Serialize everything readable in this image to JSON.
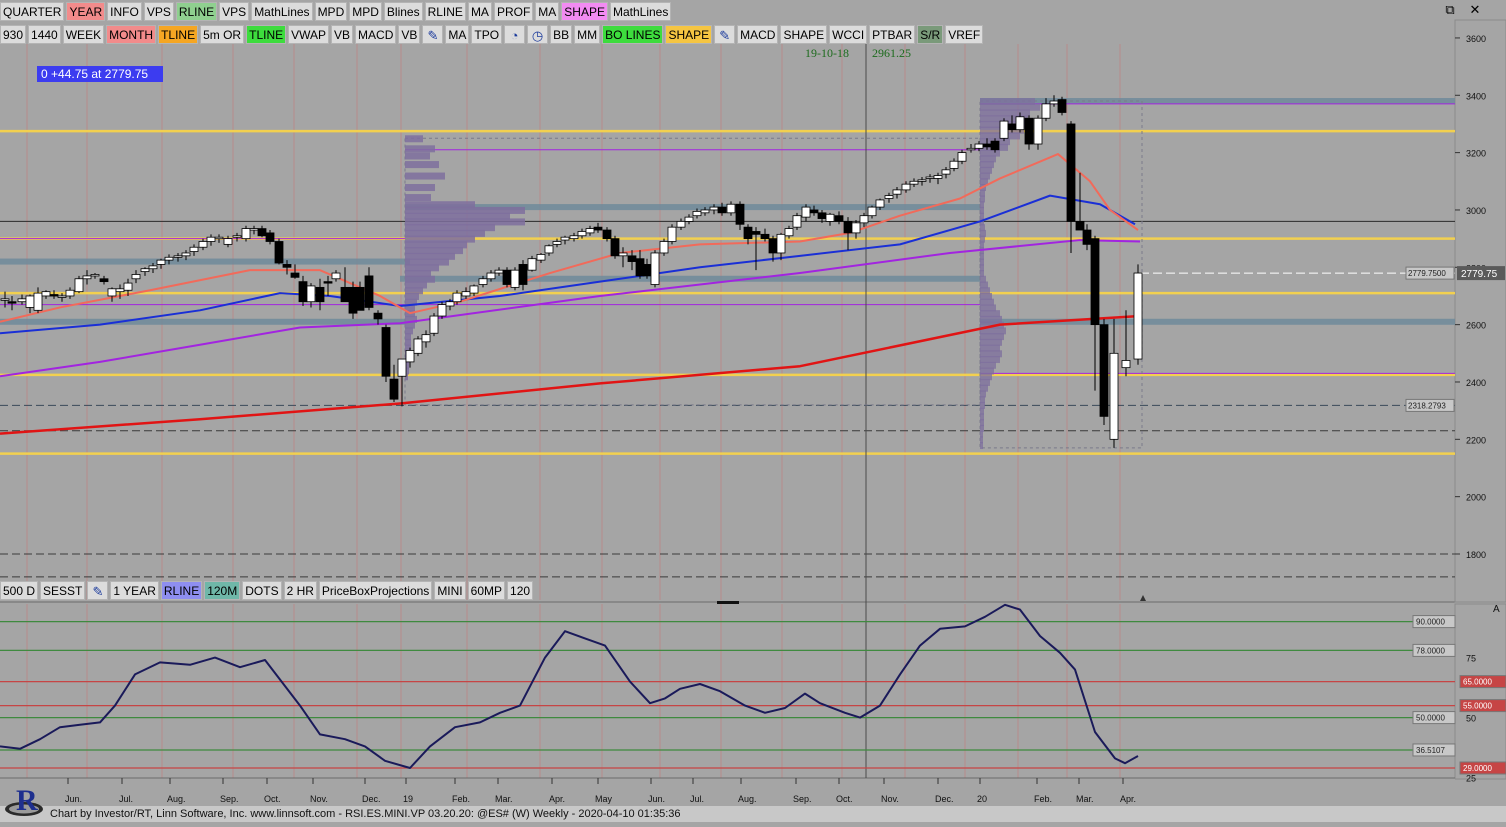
{
  "toolbar1": [
    "QUARTER",
    "YEAR",
    "INFO",
    "VPS",
    "RLINE",
    "VPS",
    "MathLines",
    "MPD",
    "MPD",
    "Blines",
    "RLINE",
    "MA",
    "PROF",
    "MA",
    "SHAPE",
    "MathLines"
  ],
  "toolbar1_colors": [
    "#dcdcdc",
    "#f28b8b",
    "#dcdcdc",
    "#dcdcdc",
    "#8fd08f",
    "#dcdcdc",
    "#dcdcdc",
    "#dcdcdc",
    "#dcdcdc",
    "#dcdcdc",
    "#dcdcdc",
    "#dcdcdc",
    "#dcdcdc",
    "#dcdcdc",
    "#f28bf2",
    "#dcdcdc"
  ],
  "toolbar2": [
    {
      "label": "930"
    },
    {
      "label": "1440"
    },
    {
      "label": "WEEK"
    },
    {
      "label": "MONTH",
      "color": "#f28b8b"
    },
    {
      "label": "TLINE",
      "color": "#f5a623"
    },
    {
      "label": "5m OR"
    },
    {
      "label": "TLINE",
      "color": "#3ddc3d"
    },
    {
      "label": "VWAP"
    },
    {
      "label": "VB"
    },
    {
      "label": "MACD"
    },
    {
      "label": "VB"
    },
    {
      "icon": "pencil-icon",
      "glyph": "✎"
    },
    {
      "label": "MA"
    },
    {
      "label": "TPO"
    },
    {
      "icon": "clock-icon",
      "glyph": "◔"
    },
    {
      "icon": "stopwatch-icon",
      "glyph": "◷"
    },
    {
      "label": "BB"
    },
    {
      "label": "MM"
    },
    {
      "label": "BO LINES",
      "color": "#3ddc3d"
    },
    {
      "label": "SHAPE",
      "color": "#f5c542"
    },
    {
      "icon": "pencil-icon",
      "glyph": "✎"
    },
    {
      "label": "MACD"
    },
    {
      "label": "SHAPE"
    },
    {
      "label": "WCCI"
    },
    {
      "label": "PTBAR"
    },
    {
      "label": "S/R",
      "color": "#7a9a7a"
    },
    {
      "label": "VREF"
    }
  ],
  "toolbar3": [
    {
      "label": "500 D"
    },
    {
      "label": "SESST"
    },
    {
      "icon": "pencil-icon",
      "glyph": "✎"
    },
    {
      "label": "1 YEAR"
    },
    {
      "label": "RLINE",
      "color": "#8e8ef0"
    },
    {
      "label": "120M",
      "color": "#6fb7a8"
    },
    {
      "label": "DOTS"
    },
    {
      "label": "2 HR"
    },
    {
      "label": "PriceBoxProjections"
    },
    {
      "label": "MINI"
    },
    {
      "label": "60MP"
    },
    {
      "label": "120"
    }
  ],
  "window_controls": {
    "restore": "⧉",
    "close": "✕"
  },
  "cursor_readout": {
    "date": "19-10-18",
    "price": "2961.25"
  },
  "info_box": "0  +44.75 at 2779.75",
  "price_axis": {
    "ticks": [
      "3600",
      "3400",
      "3200",
      "3000",
      "2800",
      "2600",
      "2400",
      "2200",
      "2000",
      "1800"
    ],
    "current_price": "2779.75",
    "marker_left": "2779.7500",
    "level_2318": "2318.2793"
  },
  "rsi_axis": {
    "labels": [
      "90.0000",
      "78.0000",
      "65.0000",
      "55.0000",
      "50.0000",
      "36.5107",
      "29.0000"
    ],
    "ticks": [
      "75",
      "50",
      "25"
    ],
    "top_marker": "A"
  },
  "x_axis": [
    "Jun.",
    "Jul.",
    "Aug.",
    "Sep.",
    "Oct.",
    "Nov.",
    "Dec.",
    "19",
    "Feb.",
    "Mar.",
    "Apr.",
    "May",
    "Jun.",
    "Jul.",
    "Aug.",
    "Sep.",
    "Oct.",
    "Nov.",
    "Dec.",
    "20",
    "Feb.",
    "Mar.",
    "Apr."
  ],
  "footer": "Chart by Investor/RT, Linn Software, Inc. www.linnsoft.com - RSI.ES.MINI.VP     03.20.20: @ES# (W) Weekly - 2020-04-10 01:35:36",
  "logo_letter": "R",
  "colors": {
    "background": "#a5a5a5",
    "up_candle": "#ffffff",
    "down_candle": "#000000",
    "ma_fast": "#f26a5a",
    "ma_mid": "#1a2fd6",
    "ma_slow": "#a224e0",
    "ma_200": "#e11414",
    "yellow_level": "#f2d04f",
    "steel_level": "#6f8a9a",
    "volume_profile": "#7e6f9e",
    "rsi_line": "#1a1a5a",
    "grid_vertical": "#b88a8a"
  },
  "chart_data": {
    "type": "candlestick",
    "series": "@ES# (W) Weekly",
    "ylim": [
      1700,
      3650
    ],
    "price_levels": {
      "yellow": [
        2150,
        2425,
        2710,
        2900,
        3275
      ],
      "steel": [
        2610,
        2760,
        2820,
        3010,
        3380
      ],
      "dashed": [
        2318.28,
        2779.75
      ]
    },
    "candles": [
      {
        "x": 5,
        "o": 2685,
        "h": 2715,
        "l": 2660,
        "c": 2690
      },
      {
        "x": 12,
        "o": 2680,
        "h": 2700,
        "l": 2650,
        "c": 2675
      },
      {
        "x": 22,
        "o": 2680,
        "h": 2705,
        "l": 2670,
        "c": 2690
      },
      {
        "x": 30,
        "o": 2660,
        "h": 2705,
        "l": 2640,
        "c": 2700
      },
      {
        "x": 38,
        "o": 2650,
        "h": 2730,
        "l": 2640,
        "c": 2710
      },
      {
        "x": 46,
        "o": 2700,
        "h": 2720,
        "l": 2690,
        "c": 2715
      },
      {
        "x": 54,
        "o": 2705,
        "h": 2720,
        "l": 2690,
        "c": 2700
      },
      {
        "x": 62,
        "o": 2695,
        "h": 2710,
        "l": 2680,
        "c": 2700
      },
      {
        "x": 70,
        "o": 2700,
        "h": 2730,
        "l": 2690,
        "c": 2720
      },
      {
        "x": 79,
        "o": 2715,
        "h": 2770,
        "l": 2710,
        "c": 2760
      },
      {
        "x": 87,
        "o": 2760,
        "h": 2790,
        "l": 2740,
        "c": 2770
      },
      {
        "x": 95,
        "o": 2770,
        "h": 2780,
        "l": 2760,
        "c": 2775
      },
      {
        "x": 104,
        "o": 2760,
        "h": 2770,
        "l": 2740,
        "c": 2750
      },
      {
        "x": 112,
        "o": 2700,
        "h": 2730,
        "l": 2680,
        "c": 2725
      },
      {
        "x": 120,
        "o": 2715,
        "h": 2740,
        "l": 2690,
        "c": 2725
      },
      {
        "x": 128,
        "o": 2720,
        "h": 2760,
        "l": 2700,
        "c": 2745
      },
      {
        "x": 136,
        "o": 2760,
        "h": 2790,
        "l": 2745,
        "c": 2775
      },
      {
        "x": 145,
        "o": 2785,
        "h": 2800,
        "l": 2770,
        "c": 2795
      },
      {
        "x": 153,
        "o": 2795,
        "h": 2815,
        "l": 2780,
        "c": 2805
      },
      {
        "x": 161,
        "o": 2810,
        "h": 2830,
        "l": 2795,
        "c": 2825
      },
      {
        "x": 169,
        "o": 2825,
        "h": 2845,
        "l": 2810,
        "c": 2835
      },
      {
        "x": 178,
        "o": 2835,
        "h": 2850,
        "l": 2820,
        "c": 2840
      },
      {
        "x": 186,
        "o": 2840,
        "h": 2860,
        "l": 2825,
        "c": 2850
      },
      {
        "x": 194,
        "o": 2855,
        "h": 2880,
        "l": 2840,
        "c": 2870
      },
      {
        "x": 203,
        "o": 2870,
        "h": 2900,
        "l": 2860,
        "c": 2890
      },
      {
        "x": 211,
        "o": 2890,
        "h": 2915,
        "l": 2875,
        "c": 2905
      },
      {
        "x": 219,
        "o": 2900,
        "h": 2915,
        "l": 2885,
        "c": 2905
      },
      {
        "x": 228,
        "o": 2880,
        "h": 2910,
        "l": 2870,
        "c": 2900
      },
      {
        "x": 237,
        "o": 2905,
        "h": 2920,
        "l": 2890,
        "c": 2910
      },
      {
        "x": 246,
        "o": 2900,
        "h": 2945,
        "l": 2890,
        "c": 2935
      },
      {
        "x": 254,
        "o": 2930,
        "h": 2945,
        "l": 2915,
        "c": 2935
      },
      {
        "x": 262,
        "o": 2935,
        "h": 2945,
        "l": 2905,
        "c": 2910
      },
      {
        "x": 270,
        "o": 2920,
        "h": 2930,
        "l": 2880,
        "c": 2890
      },
      {
        "x": 279,
        "o": 2890,
        "h": 2900,
        "l": 2810,
        "c": 2815
      },
      {
        "x": 287,
        "o": 2810,
        "h": 2825,
        "l": 2775,
        "c": 2800
      },
      {
        "x": 295,
        "o": 2780,
        "h": 2810,
        "l": 2760,
        "c": 2765
      },
      {
        "x": 303,
        "o": 2750,
        "h": 2770,
        "l": 2665,
        "c": 2680
      },
      {
        "x": 311,
        "o": 2680,
        "h": 2745,
        "l": 2660,
        "c": 2735
      },
      {
        "x": 320,
        "o": 2730,
        "h": 2760,
        "l": 2650,
        "c": 2680
      },
      {
        "x": 328,
        "o": 2750,
        "h": 2770,
        "l": 2700,
        "c": 2745
      },
      {
        "x": 336,
        "o": 2760,
        "h": 2790,
        "l": 2750,
        "c": 2780
      },
      {
        "x": 345,
        "o": 2730,
        "h": 2800,
        "l": 2680,
        "c": 2680
      },
      {
        "x": 353,
        "o": 2730,
        "h": 2750,
        "l": 2620,
        "c": 2640
      },
      {
        "x": 360,
        "o": 2730,
        "h": 2750,
        "l": 2650,
        "c": 2650
      },
      {
        "x": 369,
        "o": 2770,
        "h": 2800,
        "l": 2650,
        "c": 2660
      },
      {
        "x": 378,
        "o": 2640,
        "h": 2650,
        "l": 2600,
        "c": 2620
      },
      {
        "x": 386,
        "o": 2590,
        "h": 2600,
        "l": 2400,
        "c": 2420
      },
      {
        "x": 394,
        "o": 2410,
        "h": 2460,
        "l": 2330,
        "c": 2340
      },
      {
        "x": 402,
        "o": 2420,
        "h": 2480,
        "l": 2315,
        "c": 2480
      },
      {
        "x": 410,
        "o": 2470,
        "h": 2520,
        "l": 2450,
        "c": 2510
      },
      {
        "x": 418,
        "o": 2500,
        "h": 2560,
        "l": 2490,
        "c": 2550
      },
      {
        "x": 426,
        "o": 2540,
        "h": 2580,
        "l": 2520,
        "c": 2565
      },
      {
        "x": 434,
        "o": 2570,
        "h": 2640,
        "l": 2560,
        "c": 2630
      },
      {
        "x": 442,
        "o": 2630,
        "h": 2680,
        "l": 2620,
        "c": 2670
      },
      {
        "x": 450,
        "o": 2665,
        "h": 2690,
        "l": 2650,
        "c": 2680
      },
      {
        "x": 457,
        "o": 2680,
        "h": 2720,
        "l": 2670,
        "c": 2710
      },
      {
        "x": 466,
        "o": 2700,
        "h": 2730,
        "l": 2690,
        "c": 2715
      },
      {
        "x": 474,
        "o": 2710,
        "h": 2740,
        "l": 2700,
        "c": 2735
      },
      {
        "x": 483,
        "o": 2740,
        "h": 2770,
        "l": 2730,
        "c": 2760
      },
      {
        "x": 491,
        "o": 2760,
        "h": 2790,
        "l": 2750,
        "c": 2780
      },
      {
        "x": 499,
        "o": 2780,
        "h": 2800,
        "l": 2770,
        "c": 2790
      },
      {
        "x": 507,
        "o": 2790,
        "h": 2800,
        "l": 2730,
        "c": 2740
      },
      {
        "x": 515,
        "o": 2730,
        "h": 2800,
        "l": 2720,
        "c": 2790
      },
      {
        "x": 523,
        "o": 2810,
        "h": 2825,
        "l": 2720,
        "c": 2740
      },
      {
        "x": 532,
        "o": 2790,
        "h": 2840,
        "l": 2785,
        "c": 2830
      },
      {
        "x": 541,
        "o": 2825,
        "h": 2850,
        "l": 2815,
        "c": 2845
      },
      {
        "x": 549,
        "o": 2850,
        "h": 2880,
        "l": 2840,
        "c": 2875
      },
      {
        "x": 557,
        "o": 2880,
        "h": 2900,
        "l": 2870,
        "c": 2890
      },
      {
        "x": 565,
        "o": 2895,
        "h": 2910,
        "l": 2880,
        "c": 2905
      },
      {
        "x": 574,
        "o": 2900,
        "h": 2920,
        "l": 2890,
        "c": 2910
      },
      {
        "x": 582,
        "o": 2910,
        "h": 2935,
        "l": 2900,
        "c": 2925
      },
      {
        "x": 590,
        "o": 2920,
        "h": 2945,
        "l": 2910,
        "c": 2935
      },
      {
        "x": 598,
        "o": 2940,
        "h": 2955,
        "l": 2920,
        "c": 2930
      },
      {
        "x": 607,
        "o": 2930,
        "h": 2940,
        "l": 2890,
        "c": 2900
      },
      {
        "x": 615,
        "o": 2900,
        "h": 2910,
        "l": 2830,
        "c": 2840
      },
      {
        "x": 623,
        "o": 2840,
        "h": 2870,
        "l": 2800,
        "c": 2850
      },
      {
        "x": 632,
        "o": 2840,
        "h": 2860,
        "l": 2790,
        "c": 2820
      },
      {
        "x": 640,
        "o": 2830,
        "h": 2860,
        "l": 2760,
        "c": 2770
      },
      {
        "x": 647,
        "o": 2810,
        "h": 2830,
        "l": 2760,
        "c": 2770
      },
      {
        "x": 655,
        "o": 2740,
        "h": 2860,
        "l": 2730,
        "c": 2850
      },
      {
        "x": 664,
        "o": 2850,
        "h": 2900,
        "l": 2840,
        "c": 2890
      },
      {
        "x": 672,
        "o": 2890,
        "h": 2950,
        "l": 2880,
        "c": 2940
      },
      {
        "x": 681,
        "o": 2940,
        "h": 2970,
        "l": 2930,
        "c": 2960
      },
      {
        "x": 689,
        "o": 2960,
        "h": 2985,
        "l": 2950,
        "c": 2975
      },
      {
        "x": 697,
        "o": 2980,
        "h": 3005,
        "l": 2970,
        "c": 2995
      },
      {
        "x": 705,
        "o": 2990,
        "h": 3010,
        "l": 2980,
        "c": 3000
      },
      {
        "x": 714,
        "o": 3000,
        "h": 3020,
        "l": 2985,
        "c": 3010
      },
      {
        "x": 722,
        "o": 3010,
        "h": 3025,
        "l": 2980,
        "c": 2990
      },
      {
        "x": 731,
        "o": 2990,
        "h": 3030,
        "l": 2980,
        "c": 3020
      },
      {
        "x": 740,
        "o": 3020,
        "h": 3030,
        "l": 2930,
        "c": 2950
      },
      {
        "x": 748,
        "o": 2940,
        "h": 2950,
        "l": 2880,
        "c": 2900
      },
      {
        "x": 756,
        "o": 2925,
        "h": 2940,
        "l": 2790,
        "c": 2915
      },
      {
        "x": 765,
        "o": 2915,
        "h": 2935,
        "l": 2890,
        "c": 2900
      },
      {
        "x": 773,
        "o": 2900,
        "h": 2910,
        "l": 2820,
        "c": 2850
      },
      {
        "x": 781,
        "o": 2850,
        "h": 2920,
        "l": 2825,
        "c": 2915
      },
      {
        "x": 789,
        "o": 2910,
        "h": 2945,
        "l": 2900,
        "c": 2935
      },
      {
        "x": 797,
        "o": 2940,
        "h": 2990,
        "l": 2930,
        "c": 2980
      },
      {
        "x": 806,
        "o": 2975,
        "h": 3020,
        "l": 2960,
        "c": 3010
      },
      {
        "x": 814,
        "o": 3000,
        "h": 3015,
        "l": 2980,
        "c": 2990
      },
      {
        "x": 822,
        "o": 2990,
        "h": 3000,
        "l": 2955,
        "c": 2970
      },
      {
        "x": 830,
        "o": 2960,
        "h": 2990,
        "l": 2945,
        "c": 2985
      },
      {
        "x": 839,
        "o": 2980,
        "h": 2995,
        "l": 2950,
        "c": 2960
      },
      {
        "x": 848,
        "o": 2960,
        "h": 2975,
        "l": 2860,
        "c": 2920
      },
      {
        "x": 856,
        "o": 2920,
        "h": 2965,
        "l": 2900,
        "c": 2955
      },
      {
        "x": 864,
        "o": 2955,
        "h": 2990,
        "l": 2940,
        "c": 2980
      },
      {
        "x": 872,
        "o": 2980,
        "h": 3015,
        "l": 2970,
        "c": 3010
      },
      {
        "x": 880,
        "o": 3010,
        "h": 3040,
        "l": 3000,
        "c": 3035
      },
      {
        "x": 889,
        "o": 3040,
        "h": 3060,
        "l": 3025,
        "c": 3050
      },
      {
        "x": 897,
        "o": 3055,
        "h": 3080,
        "l": 3040,
        "c": 3070
      },
      {
        "x": 906,
        "o": 3070,
        "h": 3100,
        "l": 3060,
        "c": 3090
      },
      {
        "x": 914,
        "o": 3090,
        "h": 3110,
        "l": 3080,
        "c": 3100
      },
      {
        "x": 922,
        "o": 3100,
        "h": 3115,
        "l": 3085,
        "c": 3105
      },
      {
        "x": 930,
        "o": 3110,
        "h": 3125,
        "l": 3095,
        "c": 3115
      },
      {
        "x": 938,
        "o": 3110,
        "h": 3130,
        "l": 3090,
        "c": 3120
      },
      {
        "x": 946,
        "o": 3125,
        "h": 3150,
        "l": 3110,
        "c": 3140
      },
      {
        "x": 954,
        "o": 3145,
        "h": 3180,
        "l": 3135,
        "c": 3170
      },
      {
        "x": 962,
        "o": 3170,
        "h": 3210,
        "l": 3160,
        "c": 3200
      },
      {
        "x": 971,
        "o": 3210,
        "h": 3230,
        "l": 3200,
        "c": 3215
      },
      {
        "x": 979,
        "o": 3215,
        "h": 3240,
        "l": 3205,
        "c": 3230
      },
      {
        "x": 987,
        "o": 3230,
        "h": 3250,
        "l": 3210,
        "c": 3220
      },
      {
        "x": 995,
        "o": 3240,
        "h": 3250,
        "l": 3200,
        "c": 3210
      },
      {
        "x": 1004,
        "o": 3250,
        "h": 3320,
        "l": 3240,
        "c": 3310
      },
      {
        "x": 1012,
        "o": 3300,
        "h": 3330,
        "l": 3270,
        "c": 3280
      },
      {
        "x": 1020,
        "o": 3280,
        "h": 3340,
        "l": 3270,
        "c": 3325
      },
      {
        "x": 1029,
        "o": 3320,
        "h": 3330,
        "l": 3210,
        "c": 3230
      },
      {
        "x": 1038,
        "o": 3230,
        "h": 3330,
        "l": 3210,
        "c": 3320
      },
      {
        "x": 1046,
        "o": 3320,
        "h": 3390,
        "l": 3310,
        "c": 3370
      },
      {
        "x": 1054,
        "o": 3370,
        "h": 3400,
        "l": 3360,
        "c": 3380
      },
      {
        "x": 1062,
        "o": 3385,
        "h": 3395,
        "l": 3330,
        "c": 3340
      },
      {
        "x": 1071,
        "o": 3300,
        "h": 3310,
        "l": 2850,
        "c": 2960
      },
      {
        "x": 1080,
        "o": 2960,
        "h": 3130,
        "l": 2940,
        "c": 2930
      },
      {
        "x": 1087,
        "o": 2930,
        "h": 2950,
        "l": 2860,
        "c": 2880
      },
      {
        "x": 1095,
        "o": 2900,
        "h": 2910,
        "l": 2370,
        "c": 2600
      },
      {
        "x": 1104,
        "o": 2600,
        "h": 2620,
        "l": 2250,
        "c": 2280
      },
      {
        "x": 1114,
        "o": 2200,
        "h": 2620,
        "l": 2170,
        "c": 2500
      },
      {
        "x": 1126,
        "o": 2450,
        "h": 2650,
        "l": 2420,
        "c": 2475
      },
      {
        "x": 1138,
        "o": 2480,
        "h": 2810,
        "l": 2460,
        "c": 2780
      }
    ],
    "rsi": {
      "ylim": [
        24,
        100
      ],
      "levels": [
        29,
        36.5107,
        50,
        55,
        65,
        78,
        90
      ],
      "last": 36.5107
    }
  }
}
